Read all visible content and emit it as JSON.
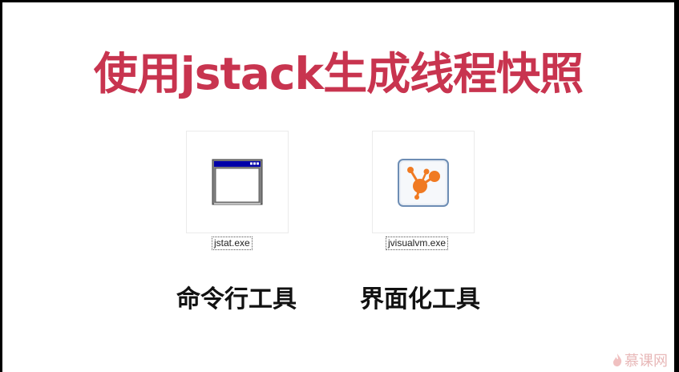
{
  "slide": {
    "title": "使用jstack生成线程快照"
  },
  "tools": [
    {
      "filename": "jstat.exe",
      "caption": "命令行工具",
      "icon": "window-app-icon"
    },
    {
      "filename": "jvisualvm.exe",
      "caption": "界面化工具",
      "icon": "visualvm-icon"
    }
  ],
  "watermark": {
    "text": "慕课网"
  },
  "colors": {
    "title": "#c8344f",
    "accent_orange": "#f07a22"
  }
}
